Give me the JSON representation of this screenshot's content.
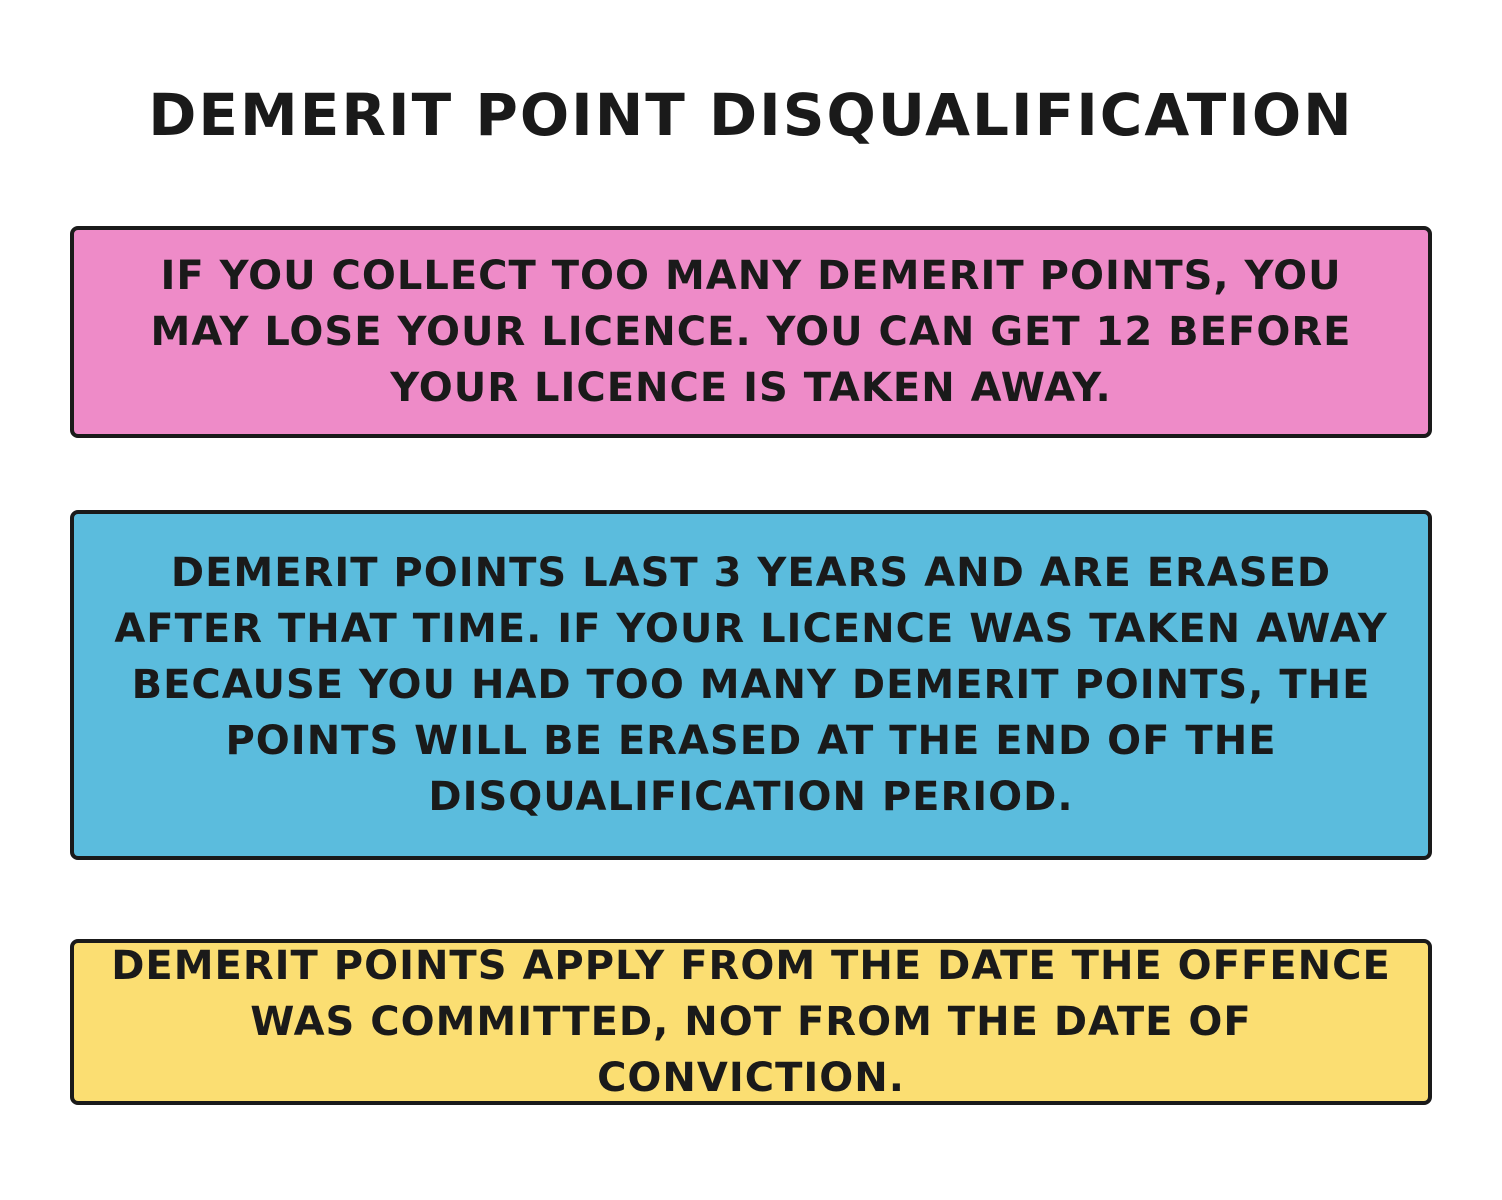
{
  "title": "DEMERIT POINT DISQUALIFICATION",
  "boxes": [
    {
      "text": "IF YOU COLLECT TOO MANY DEMERIT POINTS, YOU MAY LOSE YOUR LICENCE. YOU CAN GET 12 BEFORE YOUR LICENCE IS TAKEN AWAY.",
      "color": "#EE8BC8"
    },
    {
      "text": "DEMERIT POINTS LAST 3 YEARS AND ARE ERASED AFTER THAT TIME. IF YOUR LICENCE WAS TAKEN AWAY BECAUSE YOU HAD TOO MANY DEMERIT POINTS, THE POINTS WILL BE ERASED AT THE END OF THE DISQUALIFICATION PERIOD.",
      "color": "#5BBCDD"
    },
    {
      "text": "DEMERIT POINTS APPLY FROM THE DATE THE OFFENCE WAS COMMITTED, NOT FROM THE DATE OF CONVICTION.",
      "color": "#FBDE72"
    }
  ]
}
